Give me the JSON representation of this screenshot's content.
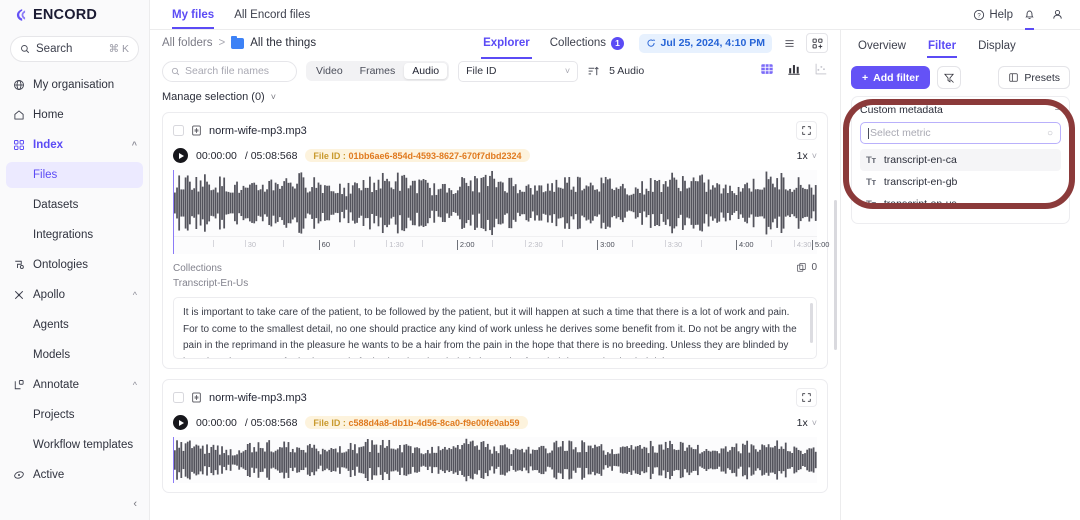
{
  "brand": {
    "name": "ENCORD",
    "accent": "#5b4bf5"
  },
  "sidebar": {
    "search": {
      "label": "Search",
      "shortcut": "⌘ K"
    },
    "items": [
      {
        "label": "My organisation",
        "icon": "globe-icon"
      },
      {
        "label": "Home",
        "icon": "home-icon"
      },
      {
        "label": "Index",
        "icon": "grid-icon",
        "expanded": true
      },
      {
        "label": "Files"
      },
      {
        "label": "Datasets"
      },
      {
        "label": "Integrations"
      },
      {
        "label": "Ontologies",
        "icon": "ontology-icon"
      },
      {
        "label": "Apollo",
        "icon": "apollo-icon",
        "expanded": true
      },
      {
        "label": "Agents"
      },
      {
        "label": "Models"
      },
      {
        "label": "Annotate",
        "icon": "annotate-icon",
        "expanded": true
      },
      {
        "label": "Projects"
      },
      {
        "label": "Workflow templates"
      },
      {
        "label": "Active",
        "icon": "active-icon"
      }
    ],
    "collapse": "‹"
  },
  "topbar": {
    "tabs": [
      {
        "label": "My files",
        "active": true
      },
      {
        "label": "All Encord files",
        "active": false
      }
    ],
    "help": "Help",
    "bell_icon": "bell-icon",
    "user_icon": "user-icon"
  },
  "breadcrumb": {
    "root": "All folders",
    "separator": ">",
    "folder": "All the things",
    "tabs": [
      {
        "label": "Explorer",
        "active": true,
        "count": ""
      },
      {
        "label": "Collections",
        "active": false,
        "count": "1"
      }
    ],
    "timestamp": "Jul 25, 2024, 4:10 PM",
    "refresh_icon": "refresh-icon",
    "list-view-icon": "list-view-icon",
    "grid-add-icon": "grid-add-icon"
  },
  "filterbar": {
    "search_placeholder": "Search file names",
    "segments": [
      {
        "label": "Video",
        "active": false
      },
      {
        "label": "Frames",
        "active": false
      },
      {
        "label": "Audio",
        "active": true
      }
    ],
    "sort_field": "File ID",
    "sort_icon": "sort-asc-icon",
    "count": "5 Audio",
    "views": [
      {
        "icon": "grid-view-icon",
        "active": true
      },
      {
        "icon": "bar-chart-icon",
        "active": false
      },
      {
        "icon": "scatter-chart-icon",
        "active": false
      }
    ]
  },
  "manage_selection": "Manage selection (0)",
  "cards": [
    {
      "filename": "norm-wife-mp3.mp3",
      "current_time": "00:00:00",
      "duration": "/ 05:08:568",
      "fileid_key": "File ID :",
      "fileid_value": "01bb6ae6-854d-4593-8627-670f7dbd2324",
      "speed": "1x",
      "ruler": [
        "30",
        "60",
        "1:30",
        "2:00",
        "2:30",
        "3:00",
        "3:30",
        "4:00",
        "4:30",
        "5:00"
      ],
      "collections_label": "Collections",
      "metadata_label": "Transcript-En-Us",
      "collections_count": "0",
      "transcript": "It is important to take care of the patient, to be followed by the patient, but it will happen at such a time that there is a lot of work and pain. For to come to the smallest detail, no one should practice any kind of work unless he derives some benefit from it. Do not be angry with the pain in the reprimand in the pleasure he wants to be a hair from the pain in the hope that there is no breeding. Unless they are blinded by lust, they do not come forth; they are in fault who abandon their duties and soften their hearts, that is, their labors."
    },
    {
      "filename": "norm-wife-mp3.mp3",
      "current_time": "00:00:00",
      "duration": "/ 05:08:568",
      "fileid_key": "File ID :",
      "fileid_value": "c588d4a8-db1b-4d56-8ca0-f9e00fe0ab59",
      "speed": "1x"
    }
  ],
  "rightpanel": {
    "tabs": [
      {
        "label": "Overview",
        "active": false
      },
      {
        "label": "Filter",
        "active": true
      },
      {
        "label": "Display",
        "active": false
      }
    ],
    "add_filter": "Add filter",
    "clear_filter_icon": "clear-filter-icon",
    "presets": "Presets",
    "filter_group": {
      "title": "Custom metadata",
      "collapse": "−",
      "metric_placeholder": "Select metric",
      "options": [
        {
          "label": "transcript-en-ca",
          "type_icon": "text-type-icon",
          "highlighted": true
        },
        {
          "label": "transcript-en-gb",
          "type_icon": "text-type-icon",
          "highlighted": false
        },
        {
          "label": "transcript-en-us",
          "type_icon": "text-type-icon",
          "highlighted": false
        }
      ]
    }
  },
  "annotation": {
    "color": "#8b3a3a",
    "shape": "rounded-ring"
  }
}
